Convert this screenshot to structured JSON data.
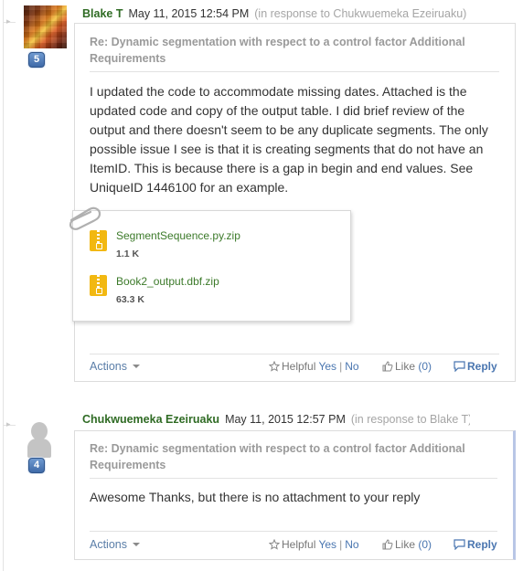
{
  "posts": [
    {
      "author": "Blake T",
      "date": "May 11, 2015 12:54 PM",
      "in_response": "(in response to Chukwuemeka Ezeiruaku)",
      "badge": "5",
      "avatar_icon": "pixelated-user-photo",
      "subject": "Re: Dynamic segmentation with respect to a control factor Additional Requirements",
      "body": "I updated the code to accommodate missing dates. Attached is the updated code and copy of the output table. I did brief review of the output and there doesn't seem to be any duplicate segments. The only possible issue I see is that it is creating segments that do not have an ItemID. This is because there is a gap in begin and end values. See UniqueID 1446100 for an example.",
      "attachments": [
        {
          "name": "SegmentSequence.py.zip",
          "size": "1.1 K",
          "icon": "zip-file-icon"
        },
        {
          "name": "Book2_output.dbf.zip",
          "size": "63.3 K",
          "icon": "zip-file-icon"
        }
      ],
      "actions_label": "Actions",
      "helpful_label": "Helpful",
      "yes_label": "Yes",
      "no_label": "No",
      "like_label": "Like",
      "like_count": "(0)",
      "reply_label": "Reply"
    },
    {
      "author": "Chukwuemeka Ezeiruaku",
      "date": "May 11, 2015 12:57 PM",
      "in_response": "(in response to Blake T)",
      "badge": "4",
      "avatar_icon": "default-user-silhouette",
      "subject": "Re: Dynamic segmentation with respect to a control factor Additional Requirements",
      "body": "Awesome Thanks, but there is no attachment to your reply",
      "actions_label": "Actions",
      "helpful_label": "Helpful",
      "yes_label": "Yes",
      "no_label": "No",
      "like_label": "Like",
      "like_count": "(0)",
      "reply_label": "Reply"
    }
  ],
  "colors": {
    "author": "#2f6b24",
    "link": "#4a76b0",
    "badge": "#3f6aa8",
    "zip_icon": "#f2b811"
  }
}
